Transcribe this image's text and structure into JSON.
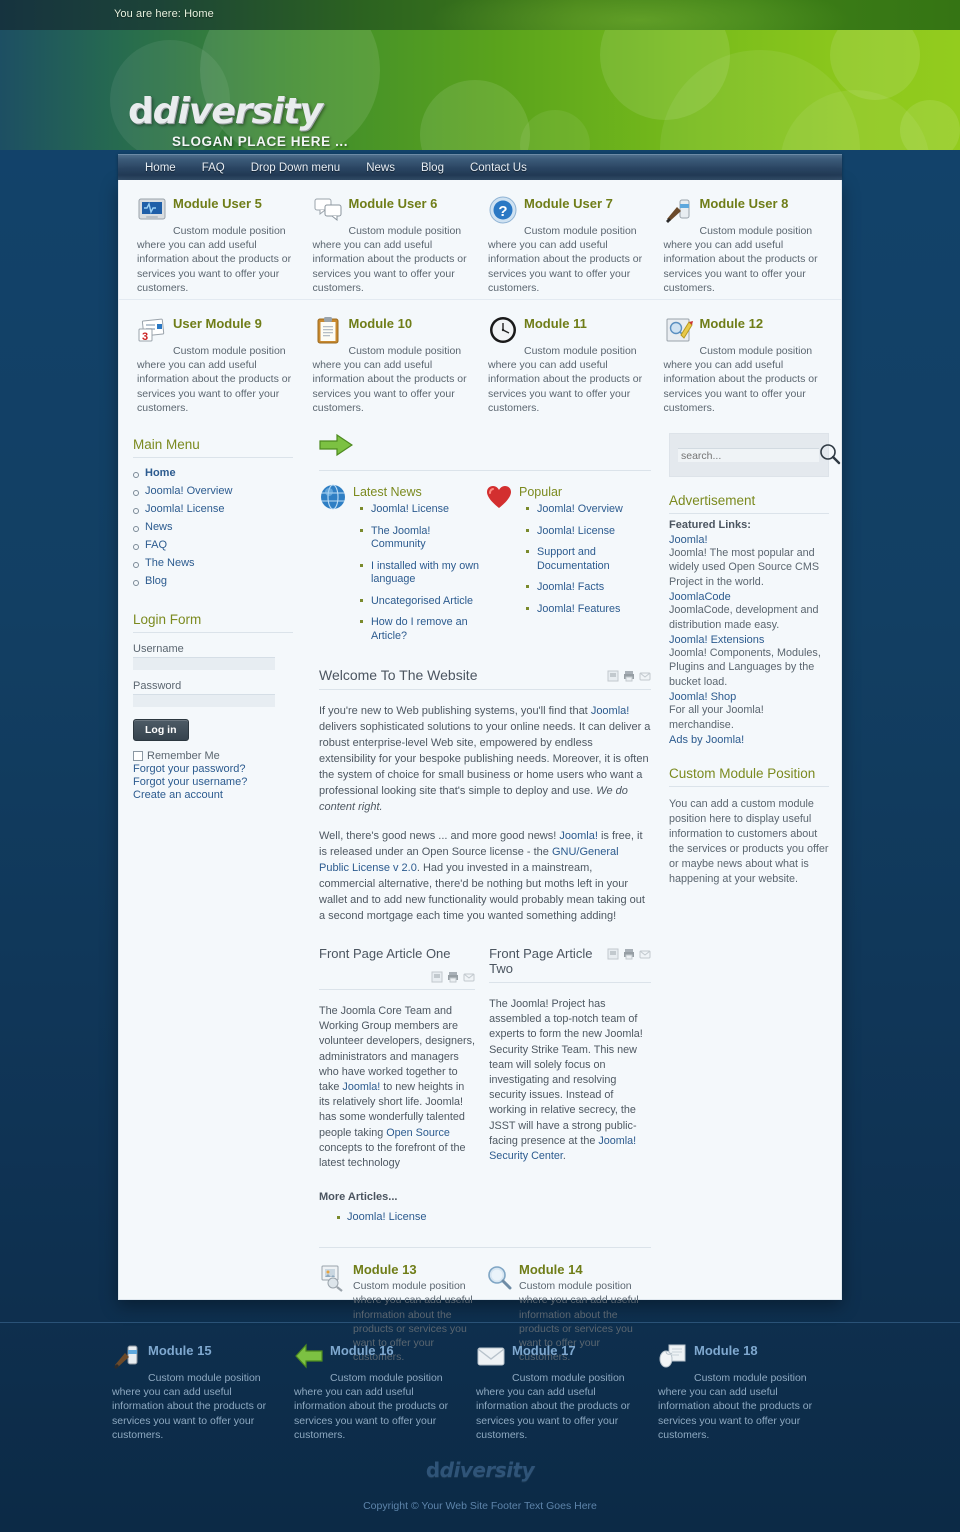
{
  "breadcrumb": {
    "text": "You are here: Home"
  },
  "brand": {
    "logo_prefix": "d",
    "logo_text": "diversity",
    "slogan": "SLOGAN PLACE HERE ..."
  },
  "nav": {
    "items": [
      {
        "label": "Home"
      },
      {
        "label": "FAQ"
      },
      {
        "label": "Drop Down menu"
      },
      {
        "label": "News"
      },
      {
        "label": "Blog"
      },
      {
        "label": "Contact Us"
      }
    ]
  },
  "top_modules_row1": [
    {
      "title": "Module User 5",
      "icon": "monitor-icon",
      "first": "Custom module position",
      "rest": "where you can  add useful information about the products or services you want to offer your customers."
    },
    {
      "title": "Module User 6",
      "icon": "chat-bubbles-icon",
      "first": "Custom module position",
      "rest": "where you can  add useful information about the products or services you want to offer your customers."
    },
    {
      "title": "Module User 7",
      "icon": "question-mark-icon",
      "first": "Custom module position",
      "rest": "where you can  add useful information about the products or services you want to offer your customers."
    },
    {
      "title": "Module User 8",
      "icon": "paintbrush-icon",
      "first": "Custom module position",
      "rest": "where you can  add useful information about the products or services you want to offer your customers."
    }
  ],
  "top_modules_row2": [
    {
      "title": "User Module 9",
      "icon": "newspaper-calendar-icon",
      "first": "Custom module position",
      "rest": "where you can add useful information about the products or services you want to offer your customers."
    },
    {
      "title": "Module 10",
      "icon": "clipboard-icon",
      "first": "Custom module position",
      "rest": "where you can  add useful information about the products or services you want to offer your customers."
    },
    {
      "title": "Module 11",
      "icon": "clock-icon",
      "first": "Custom module position",
      "rest": "where you can  add useful information about the products or services you want to offer your customers."
    },
    {
      "title": "Module 12",
      "icon": "edit-search-icon",
      "first": "Custom module position",
      "rest": "where you can  add useful information about the products or services you want to offer your customers."
    }
  ],
  "sidebar_left": {
    "main_menu": {
      "title": "Main Menu",
      "items": [
        {
          "label": "Home",
          "active": true
        },
        {
          "label": "Joomla! Overview",
          "active": false
        },
        {
          "label": "Joomla! License",
          "active": false
        },
        {
          "label": "News",
          "active": false
        },
        {
          "label": "FAQ",
          "active": false
        },
        {
          "label": "The News",
          "active": false
        },
        {
          "label": "Blog",
          "active": false
        }
      ]
    },
    "login_form": {
      "title": "Login Form",
      "username_label": "Username",
      "username_value": "",
      "password_label": "Password",
      "password_value": "",
      "login_button": "Log in",
      "remember_label": "Remember Me",
      "links": [
        {
          "label": "Forgot your password?"
        },
        {
          "label": "Forgot your username?"
        },
        {
          "label": "Create an account"
        }
      ]
    }
  },
  "news_blocks": [
    {
      "title": "Latest News",
      "icon": "globe-icon",
      "items": [
        {
          "label": "Joomla! License"
        },
        {
          "label": "The Joomla! Community"
        },
        {
          "label": "I installed with my own language"
        },
        {
          "label": "Uncategorised Article"
        },
        {
          "label": "How do I remove an Article?"
        }
      ]
    },
    {
      "title": "Popular",
      "icon": "heart-icon",
      "items": [
        {
          "label": "Joomla! Overview"
        },
        {
          "label": "Joomla! License"
        },
        {
          "label": "Support and Documentation"
        },
        {
          "label": "Joomla! Facts"
        },
        {
          "label": "Joomla! Features"
        }
      ]
    }
  ],
  "welcome": {
    "title": "Welcome To The Website",
    "p1_a": "If you're new to Web publishing systems, you'll find that ",
    "p1_link": "Joomla!",
    "p1_b": " delivers sophisticated solutions to your online needs. It can deliver a robust enterprise-level Web site, empowered by endless extensibility for your bespoke publishing needs. Moreover, it is often the system of choice for small business or home users who want a professional looking site that's simple to deploy and use. ",
    "p1_em": "We do content right.",
    "p2_a": "Well, there's good news ... and more good news! ",
    "p2_link1": "Joomla!",
    "p2_b": " is free, it is released under an Open Source license - the ",
    "p2_link2": "GNU/General Public License v 2.0",
    "p2_c": ". Had you invested in a mainstream, commercial alternative, there'd be nothing but moths left in your wallet and to add new functionality would probably mean taking out a second mortgage each time you wanted something adding!"
  },
  "front_page": {
    "article_one": {
      "title": "Front Page Article One",
      "p_a": "The Joomla Core Team and Working Group members are volunteer developers, designers, administrators and managers who have worked together to take ",
      "p_link1": "Joomla!",
      "p_b": " to new heights in its relatively short life. Joomla! has some wonderfully talented people taking ",
      "p_link2": "Open Source",
      "p_c": " concepts to the forefront of the latest technology"
    },
    "article_two": {
      "title": "Front Page Article Two",
      "p_a": "The Joomla! Project has assembled a top-notch team of experts to form the new Joomla! Security Strike Team. This new team will solely focus on investigating and resolving security issues. Instead of working in relative secrecy, the JSST will have a strong public-facing presence at the ",
      "p_link": "Joomla! Security Center",
      "p_b": "."
    },
    "more_title": "More Articles...",
    "more_items": [
      {
        "label": "Joomla! License"
      }
    ]
  },
  "bottom_modules": [
    {
      "title": "Module 13",
      "icon": "image-search-icon",
      "text": "Custom module position where you can  add useful information about the products or services you want to offer your customers."
    },
    {
      "title": "Module 14",
      "icon": "magnifier-icon",
      "text": "Custom module position where you can  add useful information about the products or services you want to offer your customers."
    }
  ],
  "sidebar_right": {
    "search": {
      "placeholder": "search...",
      "value": "",
      "icon": "search-icon"
    },
    "advertisement": {
      "title": "Advertisement",
      "featured_label": "Featured Links:",
      "links": [
        {
          "label": "Joomla!",
          "desc": "Joomla! The most popular and widely used Open Source CMS Project in the world."
        },
        {
          "label": "JoomlaCode",
          "desc": "JoomlaCode, development and distribution made easy."
        },
        {
          "label": "Joomla! Extensions",
          "desc": "Joomla! Components, Modules, Plugins and Languages by the bucket load."
        },
        {
          "label": "Joomla! Shop",
          "desc": "For all your Joomla! merchandise."
        }
      ],
      "ads_by": "Ads by Joomla!"
    },
    "custom_module": {
      "title": "Custom Module Position",
      "text": "You can add a custom module position here to display useful information to customers about the services or products you offer or maybe news about what is happening at your website."
    }
  },
  "footer_modules": [
    {
      "title": "Module 15",
      "icon": "paintbrush-icon",
      "first": "Custom module position",
      "rest": "where you can  add useful information about the products or services you want to offer your customers."
    },
    {
      "title": "Module 16",
      "icon": "green-arrow-left-icon",
      "first": "Custom module position",
      "rest": "where you can  add useful information about the products or services you want to offer your customers."
    },
    {
      "title": "Module 17",
      "icon": "envelope-icon",
      "first": "Custom module position",
      "rest": "where you can  add useful information about the products or services you want to offer your customers."
    },
    {
      "title": "Module 18",
      "icon": "mouse-document-icon",
      "first": "Custom module position",
      "rest": "where you can  add useful information about the products or services you want to offer your customers."
    }
  ],
  "footer": {
    "logo_prefix": "d",
    "logo_text": "diversity",
    "copyright": "Copyright © Your Web Site Footer Text Goes Here"
  },
  "colors": {
    "green_accent": "#7b8a1f",
    "link_blue": "#2c5b8f",
    "header_green": "#5aa31c",
    "page_bg": "#12436c"
  }
}
